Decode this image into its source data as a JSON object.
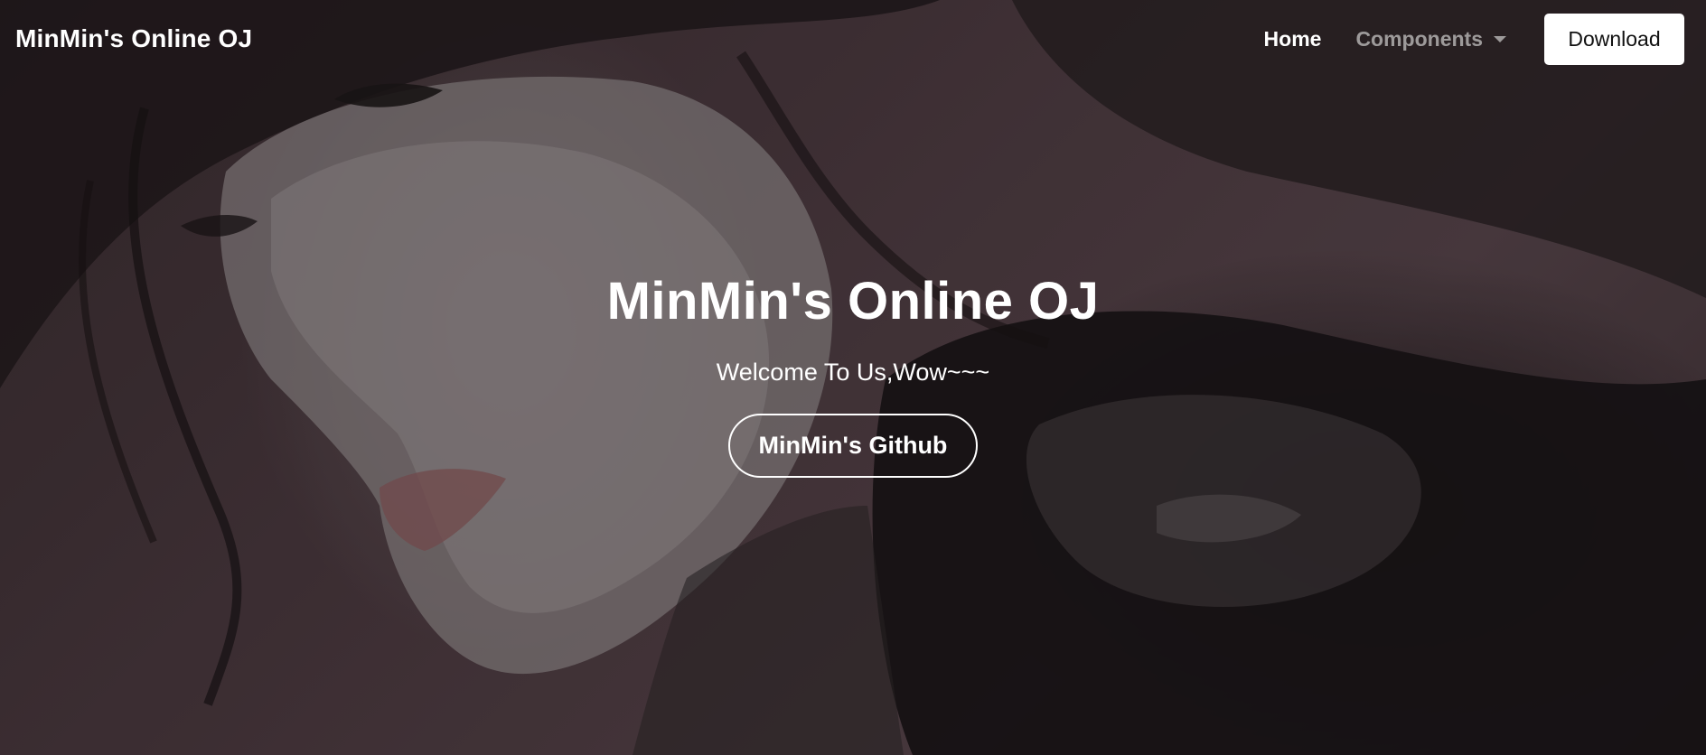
{
  "navbar": {
    "brand": "MinMin's Online OJ",
    "links": [
      {
        "label": "Home"
      },
      {
        "label": "Components"
      }
    ],
    "download_label": "Download"
  },
  "hero": {
    "title": "MinMin's Online OJ",
    "subtitle": "Welcome To Us,Wow~~~",
    "button_label": "MinMin's Github"
  },
  "colors": {
    "background": "#4a3a40",
    "text": "#ffffff",
    "muted_link": "#9a9094",
    "button_bg": "#ffffff"
  }
}
